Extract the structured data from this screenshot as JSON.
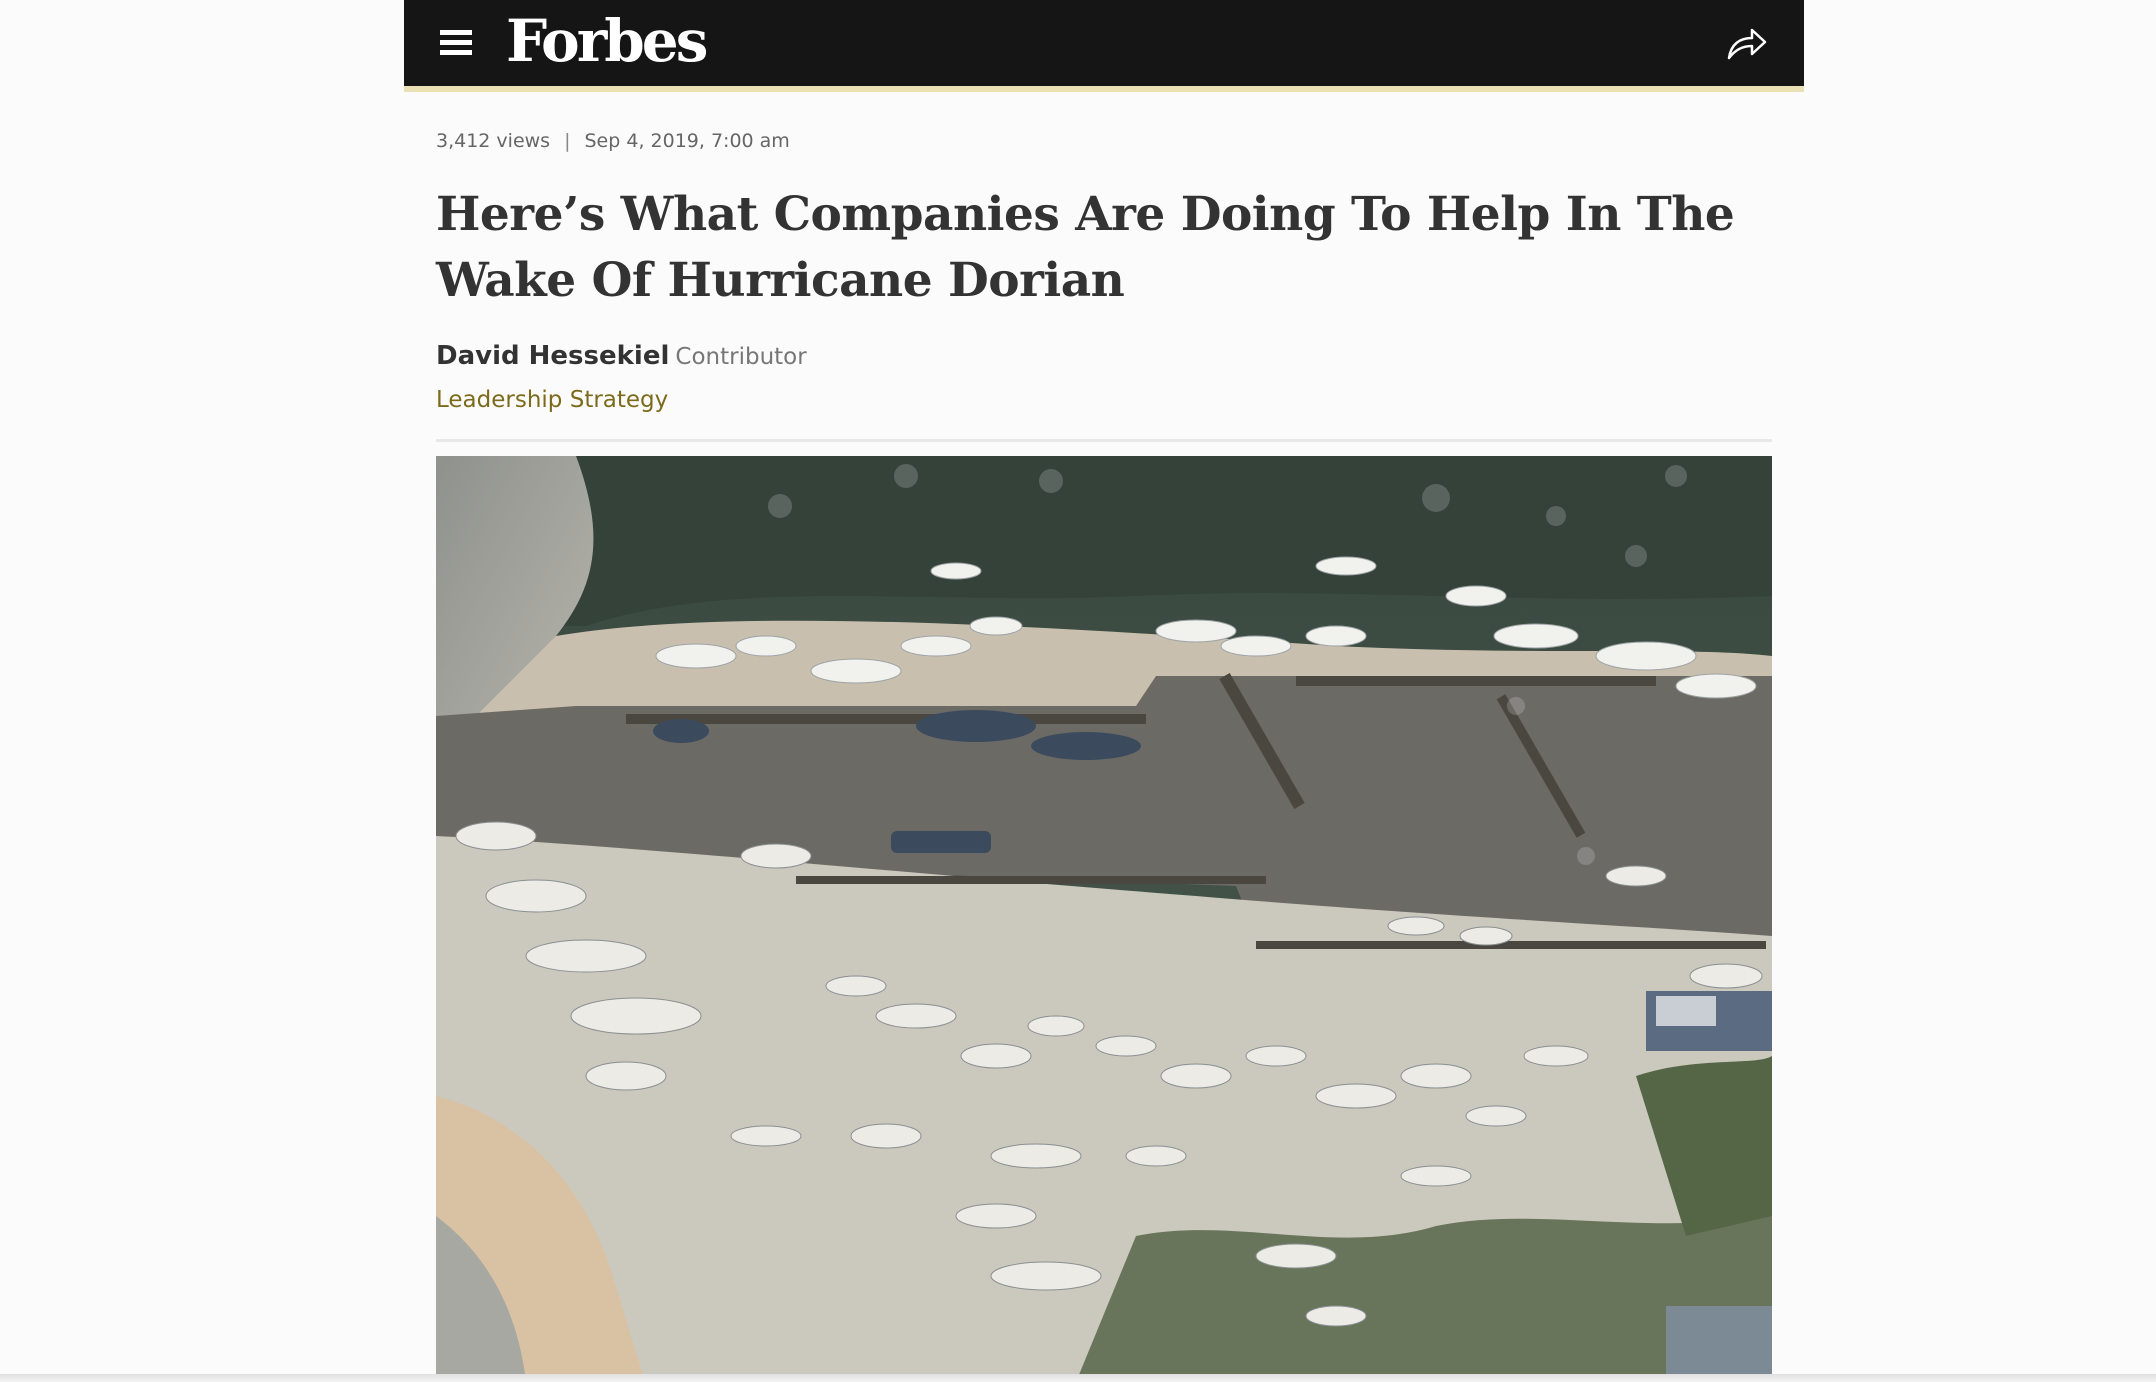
{
  "header": {
    "logo_text": "Forbes",
    "menu_icon": "hamburger-menu-icon",
    "share_icon": "share-arrow-icon",
    "background_color": "#151515",
    "accent_color": "#ece0b5"
  },
  "article": {
    "views": "3,412 views",
    "separator": "|",
    "date": "Sep 4, 2019, 7:00 am",
    "title": "Here’s What Companies Are Doing To Help In The Wake Of Hurricane Dorian",
    "author": "David Hessekiel",
    "author_role": "Contributor",
    "channel": "Leadership Strategy",
    "channel_color": "#7d6b1c"
  },
  "hero_image": {
    "alt": "Aerial view of a marina with boats piled on shore after Hurricane Dorian"
  }
}
